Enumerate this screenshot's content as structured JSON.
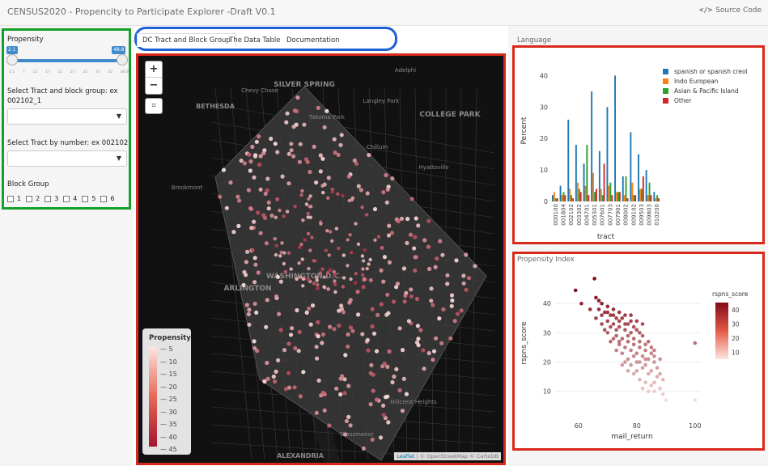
{
  "header": {
    "title": "CENSUS2020 - Propencity to Participate Explorer -Draft V0.1",
    "source_icon": "</>",
    "source_label": "Source Code"
  },
  "sidebar": {
    "propensity_label": "Propensity",
    "slider_min": "2.1",
    "slider_max": "48.8",
    "slider_ticks": [
      "2.1",
      "7",
      "12",
      "17",
      "22",
      "27",
      "32",
      "37",
      "42",
      "48.8"
    ],
    "tract_block_label": "Select Tract and block group: ex 002102_1",
    "tract_block_value": "",
    "tract_number_label": "Select Tract by number: ex 002102",
    "tract_number_value": "",
    "block_group_label": "Block Group",
    "block_groups": [
      "1",
      "2",
      "3",
      "4",
      "5",
      "6"
    ]
  },
  "tabs": [
    {
      "label": "DC Tract and Block Group",
      "active": true
    },
    {
      "label": "The Data Table",
      "active": false
    },
    {
      "label": "Documentation",
      "active": false
    }
  ],
  "map": {
    "zoom_in": "+",
    "zoom_out": "−",
    "fit_icon": "⌗",
    "place_labels": [
      "SILVER SPRING",
      "Takoma Park",
      "Adelphi",
      "Langley Park",
      "Chevy Chase",
      "BETHESDA",
      "COLLEGE PARK",
      "Chillum",
      "Hyattsville",
      "Brookmont",
      "ARLINGTON",
      "Hillcrest Heights",
      "Glassmanor",
      "ALEXANDRIA",
      "WASHINGTON D.C."
    ],
    "legend_title": "Propensity",
    "legend_ticks": [
      "5",
      "10",
      "15",
      "20",
      "25",
      "30",
      "35",
      "40",
      "45"
    ],
    "attribution_leaflet": "Leaflet",
    "attribution_rest": "| © OpenStreetMap © CartoDB"
  },
  "language_panel": {
    "label": "Language",
    "colors": {
      "spanish": "#1f77b4",
      "indo": "#ff7f0e",
      "asian": "#2ca02c",
      "other": "#d62728"
    }
  },
  "propensity_panel": {
    "label": "Propensity Index"
  },
  "chart_data": [
    {
      "type": "bar",
      "title": "",
      "xlabel": "tract",
      "ylabel": "Percent",
      "ylim": [
        0,
        45
      ],
      "yticks": [
        0,
        10,
        20,
        30,
        40
      ],
      "legend_position": "top-right",
      "categories": [
        "000100",
        "001804",
        "002102",
        "003302",
        "004701",
        "005301",
        "007601",
        "007703",
        "007901",
        "008002",
        "009102",
        "009503",
        "009803",
        "010200"
      ],
      "series": [
        {
          "name": "spanish or spanish creol",
          "values": [
            2,
            5,
            26,
            18,
            12,
            35,
            16,
            30,
            40,
            8,
            22,
            15,
            10,
            3
          ]
        },
        {
          "name": "Indo European",
          "values": [
            3,
            2,
            4,
            6,
            5,
            9,
            4,
            5,
            3,
            2,
            6,
            4,
            2,
            1
          ]
        },
        {
          "name": "Asian & Pacific Island",
          "values": [
            1,
            3,
            2,
            4,
            18,
            3,
            2,
            6,
            3,
            8,
            2,
            4,
            6,
            2
          ]
        },
        {
          "name": "Other",
          "values": [
            1,
            2,
            1,
            3,
            2,
            4,
            12,
            2,
            3,
            1,
            2,
            8,
            2,
            1
          ]
        }
      ]
    },
    {
      "type": "scatter",
      "title": "",
      "xlabel": "mail_return",
      "ylabel": "rspns_score",
      "xlim": [
        52,
        102
      ],
      "ylim": [
        3,
        50
      ],
      "xticks": [
        60,
        80,
        100
      ],
      "yticks": [
        10,
        20,
        30,
        40
      ],
      "colorbar": {
        "title": "rspns_score",
        "ticks": [
          10,
          20,
          30,
          40
        ]
      },
      "points": [
        [
          65.5,
          48.5
        ],
        [
          59,
          44.5
        ],
        [
          61,
          40
        ],
        [
          64,
          38
        ],
        [
          66,
          42
        ],
        [
          67,
          41
        ],
        [
          68,
          40
        ],
        [
          70,
          39
        ],
        [
          69,
          37
        ],
        [
          71,
          36
        ],
        [
          72,
          38
        ],
        [
          74,
          37
        ],
        [
          73,
          35
        ],
        [
          75,
          35
        ],
        [
          76,
          36
        ],
        [
          78,
          34
        ],
        [
          77,
          33
        ],
        [
          79,
          32
        ],
        [
          80,
          31
        ],
        [
          81,
          30
        ],
        [
          82,
          29
        ],
        [
          78,
          30
        ],
        [
          76,
          31
        ],
        [
          74,
          32
        ],
        [
          73,
          31
        ],
        [
          72,
          33
        ],
        [
          70,
          34
        ],
        [
          71,
          32
        ],
        [
          75,
          28
        ],
        [
          77,
          27
        ],
        [
          79,
          26
        ],
        [
          81,
          25
        ],
        [
          83,
          24
        ],
        [
          85,
          23
        ],
        [
          84,
          21
        ],
        [
          86,
          20
        ],
        [
          82,
          22
        ],
        [
          80,
          23
        ],
        [
          78,
          24
        ],
        [
          76,
          25
        ],
        [
          74,
          27
        ],
        [
          73,
          29
        ],
        [
          83,
          19
        ],
        [
          85,
          17
        ],
        [
          87,
          15
        ],
        [
          86,
          13
        ],
        [
          88,
          11
        ],
        [
          89,
          9
        ],
        [
          90,
          7
        ],
        [
          87,
          18
        ],
        [
          84,
          16
        ],
        [
          82,
          18
        ],
        [
          80,
          20
        ],
        [
          79,
          22
        ],
        [
          77,
          21
        ],
        [
          75,
          23
        ],
        [
          81,
          14
        ],
        [
          83,
          13
        ],
        [
          85,
          12
        ],
        [
          80,
          17
        ],
        [
          78,
          19
        ],
        [
          76,
          20
        ],
        [
          100,
          26.5
        ],
        [
          100,
          7
        ],
        [
          66,
          35
        ],
        [
          68,
          33
        ],
        [
          70,
          30
        ],
        [
          72,
          28
        ],
        [
          69,
          31
        ],
        [
          74,
          26
        ],
        [
          77,
          29
        ],
        [
          79,
          28
        ],
        [
          81,
          27
        ],
        [
          83,
          26
        ],
        [
          85,
          25
        ],
        [
          86,
          22
        ],
        [
          88,
          21
        ],
        [
          88,
          16
        ],
        [
          86,
          10
        ],
        [
          84,
          10
        ],
        [
          82,
          11
        ],
        [
          89,
          14
        ],
        [
          79,
          16
        ],
        [
          77,
          17
        ],
        [
          75,
          19
        ],
        [
          73,
          24
        ],
        [
          71,
          27
        ],
        [
          81,
          20
        ],
        [
          83,
          21
        ],
        [
          84,
          27
        ],
        [
          86,
          24
        ],
        [
          78,
          36
        ],
        [
          80,
          34
        ],
        [
          82,
          33
        ],
        [
          76,
          33
        ],
        [
          74,
          34
        ],
        [
          72,
          36
        ],
        [
          70,
          37
        ],
        [
          68,
          36
        ],
        [
          67,
          38
        ]
      ]
    }
  ]
}
